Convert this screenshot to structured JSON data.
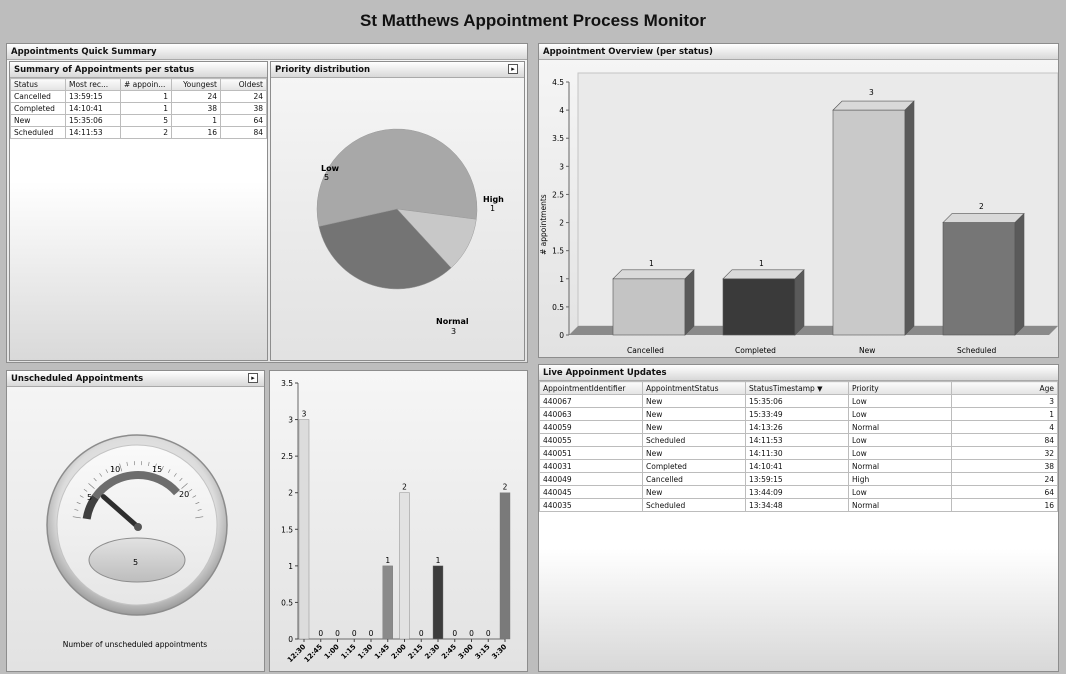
{
  "app_title": "St Matthews Appointment Process Monitor",
  "quick_summary": {
    "title": "Appointments Quick Summary",
    "status_table": {
      "title": "Summary of Appointments per status",
      "headers": [
        "Status",
        "Most rec...",
        "# appoin...",
        "Youngest",
        "Oldest"
      ],
      "rows": [
        [
          "Cancelled",
          "13:59:15",
          "1",
          "24",
          "24"
        ],
        [
          "Completed",
          "14:10:41",
          "1",
          "38",
          "38"
        ],
        [
          "New",
          "15:35:06",
          "5",
          "1",
          "64"
        ],
        [
          "Scheduled",
          "14:11:53",
          "2",
          "16",
          "84"
        ]
      ]
    },
    "priority": {
      "title": "Priority distribution",
      "slices": [
        {
          "label": "Low",
          "value": "5",
          "color": "#a8a8a8"
        },
        {
          "label": "High",
          "value": "1",
          "color": "#c8c8c8"
        },
        {
          "label": "Normal",
          "value": "3",
          "color": "#747474"
        }
      ]
    }
  },
  "overview": {
    "title": "Appointment Overview (per status)",
    "ylabel": "# appointments",
    "yticks": [
      "0",
      "0.5",
      "1",
      "1.5",
      "2",
      "2.5",
      "3",
      "3.5",
      "4",
      "4.5"
    ],
    "bars": [
      {
        "category": "Cancelled",
        "label": "1"
      },
      {
        "category": "Completed",
        "label": "1"
      },
      {
        "category": "New",
        "label": "3"
      },
      {
        "category": "Scheduled",
        "label": "2"
      }
    ]
  },
  "unscheduled": {
    "title": "Unscheduled Appointments",
    "gauge_ticks": [
      "5",
      "10",
      "15",
      "20"
    ],
    "value": "5",
    "caption": "Number of unscheduled appointments"
  },
  "timeline": {
    "yticks": [
      "0",
      "0.5",
      "1",
      "1.5",
      "2",
      "2.5",
      "3",
      "3.5"
    ],
    "xticks": [
      "12:30",
      "12:45",
      "1:00",
      "1:15",
      "1:30",
      "1:45",
      "2:00",
      "2:15",
      "2:30",
      "2:45",
      "3:00",
      "3:15",
      "3:30"
    ],
    "value_labels": [
      "3",
      "0",
      "0",
      "0",
      "0",
      "1",
      "2",
      "0",
      "1",
      "0",
      "0",
      "0",
      "2"
    ]
  },
  "live": {
    "title": "Live Appoinment Updates",
    "headers": [
      "AppointmentIdentifier",
      "AppointmentStatus",
      "StatusTimestamp",
      "Priority",
      "Age"
    ],
    "sort_icon": "sort-descending-icon",
    "rows": [
      [
        "440067",
        "New",
        "15:35:06",
        "Low",
        "3"
      ],
      [
        "440063",
        "New",
        "15:33:49",
        "Low",
        "1"
      ],
      [
        "440059",
        "New",
        "14:13:26",
        "Normal",
        "4"
      ],
      [
        "440055",
        "Scheduled",
        "14:11:53",
        "Low",
        "84"
      ],
      [
        "440051",
        "New",
        "14:11:30",
        "Low",
        "32"
      ],
      [
        "440031",
        "Completed",
        "14:10:41",
        "Normal",
        "38"
      ],
      [
        "440049",
        "Cancelled",
        "13:59:15",
        "High",
        "24"
      ],
      [
        "440045",
        "New",
        "13:44:09",
        "Low",
        "64"
      ],
      [
        "440035",
        "Scheduled",
        "13:34:48",
        "Normal",
        "16"
      ]
    ]
  },
  "chart_data": [
    {
      "type": "bar",
      "title": "Appointment Overview (per status)",
      "ylabel": "# appointments",
      "categories": [
        "Cancelled",
        "Completed",
        "New",
        "Scheduled"
      ],
      "values": [
        1,
        1,
        4,
        2
      ],
      "colors": [
        "#c4c4c4",
        "#3a3a3a",
        "#c9c9c9",
        "#767676"
      ],
      "ylim": [
        0,
        4.5
      ]
    },
    {
      "type": "pie",
      "title": "Priority distribution",
      "categories": [
        "Low",
        "High",
        "Normal"
      ],
      "values": [
        5,
        1,
        3
      ]
    },
    {
      "type": "bar",
      "categories": [
        "12:30",
        "12:45",
        "1:00",
        "1:15",
        "1:30",
        "1:45",
        "2:00",
        "2:15",
        "2:30",
        "2:45",
        "3:00",
        "3:15",
        "3:30"
      ],
      "values": [
        3,
        0,
        0,
        0,
        0,
        1,
        2,
        0,
        1,
        0,
        0,
        0,
        2
      ],
      "ylim": [
        0,
        3.5
      ]
    }
  ]
}
